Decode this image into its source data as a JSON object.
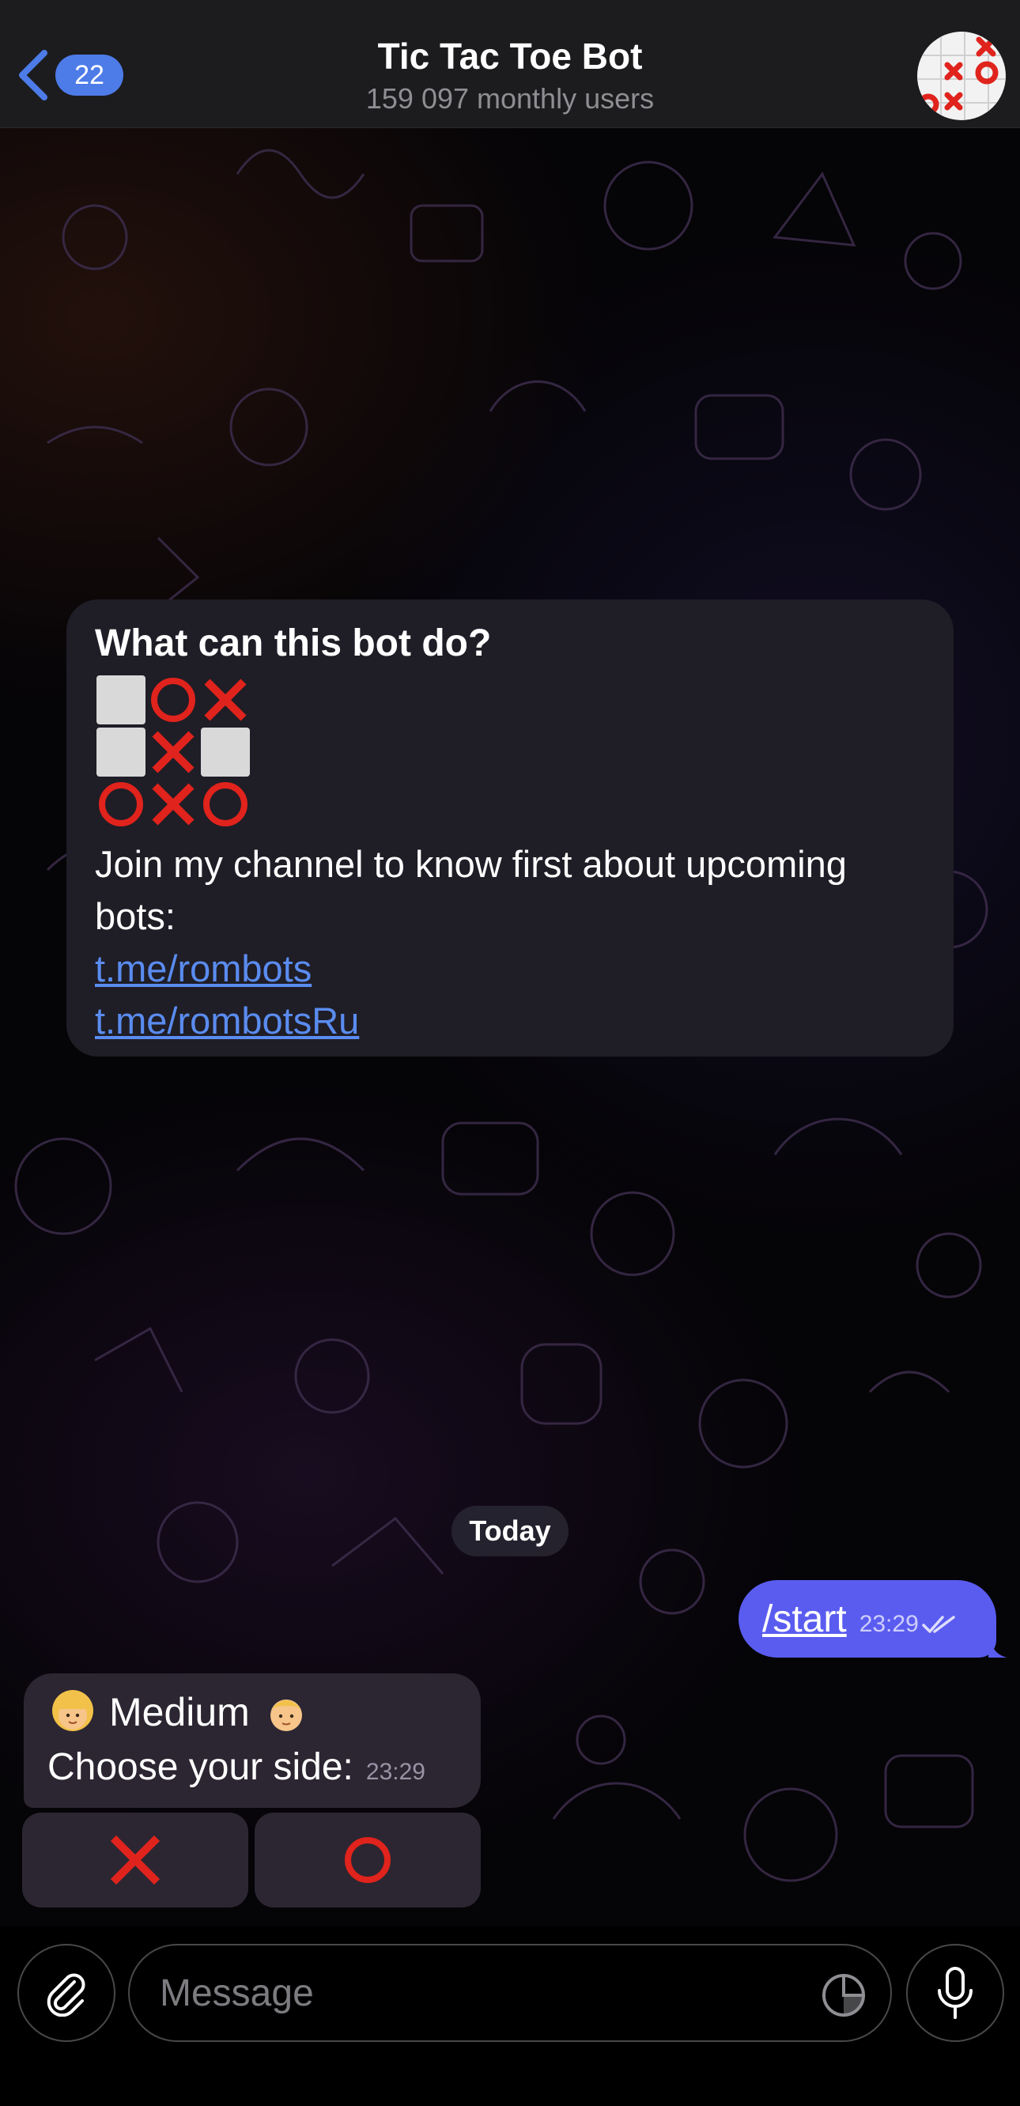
{
  "header": {
    "back_count": "22",
    "title": "Tic Tac Toe Bot",
    "subtitle": "159 097 monthly users"
  },
  "info": {
    "title": "What can this bot do?",
    "board": [
      [
        "empty",
        "O",
        "X"
      ],
      [
        "empty",
        "X",
        "empty"
      ],
      [
        "O",
        "X",
        "O"
      ]
    ],
    "text": "Join my channel to know first about upcoming bots:",
    "links": [
      "t.me/rombots",
      "t.me/rombotsRu"
    ]
  },
  "date_separator": "Today",
  "outgoing": {
    "text": "/start",
    "time": "23:29"
  },
  "incoming": {
    "line1": "Medium",
    "line2": "Choose your side:",
    "time": "23:29"
  },
  "keyboard": [
    "X",
    "O"
  ],
  "input": {
    "placeholder": "Message"
  },
  "colors": {
    "accent": "#4d7be8",
    "outgoing": "#5a5cf0",
    "link": "#5a8cf0",
    "mark": "#e0231c"
  }
}
